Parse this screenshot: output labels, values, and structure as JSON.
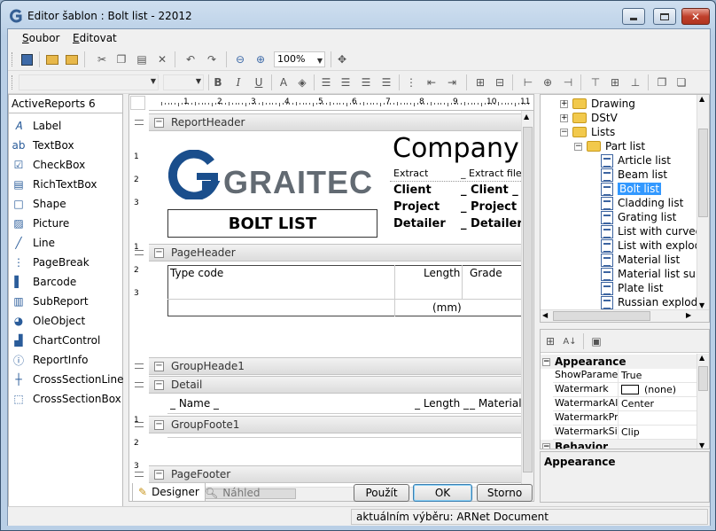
{
  "window": {
    "title": "Editor šablon : Bolt list - 22012"
  },
  "menu": {
    "items": [
      {
        "accel": "S",
        "rest": "oubor"
      },
      {
        "accel": "E",
        "rest": "ditovat"
      }
    ]
  },
  "toolbar": {
    "zoom": "100%"
  },
  "toolbox": {
    "header": "ActiveReports 6",
    "items": [
      {
        "label": "Label",
        "icon": "label-icon"
      },
      {
        "label": "TextBox",
        "icon": "textbox-icon"
      },
      {
        "label": "CheckBox",
        "icon": "checkbox-icon"
      },
      {
        "label": "RichTextBox",
        "icon": "richtextbox-icon"
      },
      {
        "label": "Shape",
        "icon": "shape-icon"
      },
      {
        "label": "Picture",
        "icon": "picture-icon"
      },
      {
        "label": "Line",
        "icon": "line-icon"
      },
      {
        "label": "PageBreak",
        "icon": "pagebreak-icon"
      },
      {
        "label": "Barcode",
        "icon": "barcode-icon"
      },
      {
        "label": "SubReport",
        "icon": "subreport-icon"
      },
      {
        "label": "OleObject",
        "icon": "oleobject-icon"
      },
      {
        "label": "ChartControl",
        "icon": "chart-icon"
      },
      {
        "label": "ReportInfo",
        "icon": "reportinfo-icon"
      },
      {
        "label": "CrossSectionLine",
        "icon": "crosssectionline-icon"
      },
      {
        "label": "CrossSectionBox",
        "icon": "crosssectionbox-icon"
      }
    ]
  },
  "ruler": {
    "h_labels": [
      "1",
      "2",
      "3",
      "4",
      "5",
      "6",
      "7",
      "8",
      "9",
      "10",
      "11"
    ],
    "v_labels": [
      "1",
      "2",
      "3",
      "1",
      "2",
      "3",
      "1",
      "2",
      "3"
    ]
  },
  "report": {
    "sections": {
      "report_header": "ReportHeader",
      "page_header": "PageHeader",
      "group_header": "GroupHeade1",
      "detail": "Detail",
      "group_footer": "GroupFoote1",
      "page_footer": "PageFooter"
    },
    "logo_text": "GRAITEC",
    "title": "BOLT LIST",
    "company": "Company",
    "info_labels": [
      "Extract",
      "Client",
      "Project",
      "Detailer"
    ],
    "info_values": [
      "_ Extract file _",
      "_ Client _",
      "_ Project n",
      "_ Detailer _"
    ],
    "columns": {
      "type_code": "Type code",
      "length": "Length",
      "grade": "Grade",
      "unit_mm": "(mm)"
    },
    "detail_fields": {
      "name": "_ Name _",
      "length": "_ Length _",
      "material": "_ Material"
    }
  },
  "tabs": {
    "designer": "Designer",
    "preview": "Náhled"
  },
  "buttons": {
    "apply": "Použít",
    "ok": "OK",
    "cancel": "Storno"
  },
  "tree": {
    "items": [
      {
        "label": "Drawing",
        "type": "folder",
        "level": 0,
        "expander": "+"
      },
      {
        "label": "DStV",
        "type": "folder",
        "level": 0,
        "expander": "+"
      },
      {
        "label": "Lists",
        "type": "folder",
        "level": 0,
        "expander": "−"
      },
      {
        "label": "Part list",
        "type": "folder",
        "level": 1,
        "expander": "−"
      },
      {
        "label": "Article list",
        "type": "doc",
        "level": 2
      },
      {
        "label": "Beam list",
        "type": "doc",
        "level": 2
      },
      {
        "label": "Bolt list",
        "type": "doc",
        "level": 2,
        "selected": true
      },
      {
        "label": "Cladding list",
        "type": "doc",
        "level": 2
      },
      {
        "label": "Grating list",
        "type": "doc",
        "level": 2
      },
      {
        "label": "List with curved",
        "type": "doc",
        "level": 2
      },
      {
        "label": "List with explode",
        "type": "doc",
        "level": 2
      },
      {
        "label": "Material list",
        "type": "doc",
        "level": 2
      },
      {
        "label": "Material list summ",
        "type": "doc",
        "level": 2
      },
      {
        "label": "Plate list",
        "type": "doc",
        "level": 2
      },
      {
        "label": "Russian explode",
        "type": "doc",
        "level": 2
      }
    ]
  },
  "properties": {
    "category": "Appearance",
    "category2": "Behavior",
    "rows": [
      {
        "name": "ShowParameters",
        "value": "True"
      },
      {
        "name": "Watermark",
        "value": "(none)"
      },
      {
        "name": "WatermarkAlignment",
        "value": "Center"
      },
      {
        "name": "WatermarkPrintOnPages",
        "value": ""
      },
      {
        "name": "WatermarkSizeMode",
        "value": "Clip"
      }
    ],
    "description_title": "Appearance"
  },
  "status": {
    "text": "aktuálním výběru: ARNet Document"
  },
  "colors": {
    "selection": "#3399ff",
    "brand": "#626a72",
    "brand_blue": "#1a4e8c"
  }
}
